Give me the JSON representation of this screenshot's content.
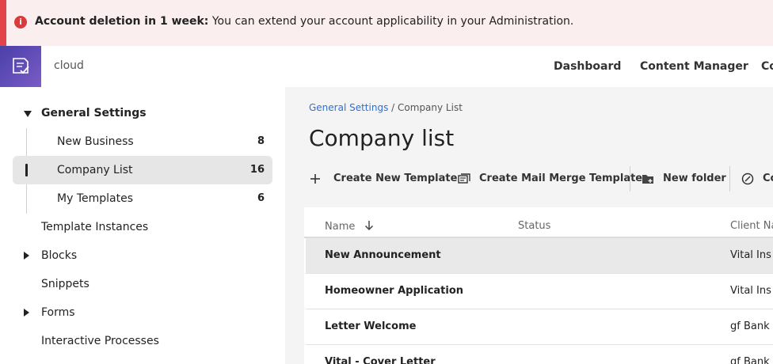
{
  "banner": {
    "title": "Account deletion in 1 week:",
    "message": "You can extend your account applicability in your Administration.",
    "icon": "info-icon",
    "color": "#e2434a"
  },
  "topbar": {
    "brand": "cloud",
    "nav": [
      "Dashboard",
      "Content Manager",
      "Co"
    ]
  },
  "sidebar": {
    "items": [
      {
        "label": "General Settings",
        "count": "",
        "expander": "expanded"
      },
      {
        "label": "New Business",
        "count": "8"
      },
      {
        "label": "Company List",
        "count": "16",
        "active": true
      },
      {
        "label": "My Templates",
        "count": "6"
      },
      {
        "label": "Template Instances",
        "count": ""
      },
      {
        "label": "Blocks",
        "count": "",
        "expander": "collapsed"
      },
      {
        "label": "Snippets",
        "count": ""
      },
      {
        "label": "Forms",
        "count": "",
        "expander": "collapsed"
      },
      {
        "label": "Interactive Processes",
        "count": ""
      }
    ]
  },
  "main": {
    "breadcrumb": {
      "link": "General Settings",
      "separator": "/",
      "current": "Company List"
    },
    "title": "Company list",
    "toolbar": {
      "create_template": "Create New Template",
      "create_mail_merge": "Create Mail Merge Template",
      "new_folder": "New folder",
      "more": "Co"
    },
    "table": {
      "columns": [
        "Name",
        "Status",
        "Client Na"
      ],
      "rows": [
        {
          "name": "New Announcement",
          "status": "",
          "client": "Vital Ins"
        },
        {
          "name": "Homeowner Application",
          "status": "",
          "client": "Vital Ins"
        },
        {
          "name": "Letter Welcome",
          "status": "",
          "client": "gf Bank"
        },
        {
          "name": "Vital - Cover Letter",
          "status": "",
          "client": "gf Bank"
        }
      ]
    }
  },
  "colors": {
    "accent_link": "#2f6fd1",
    "logo_gradient_start": "#4a3fa8",
    "logo_gradient_end": "#7a5cc6"
  }
}
